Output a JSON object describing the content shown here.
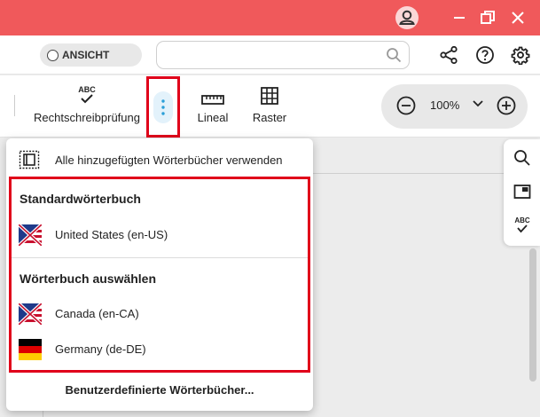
{
  "header": {
    "view_toggle_label": "ANSICHT",
    "search_placeholder": ""
  },
  "toolbar": {
    "spellcheck_label": "Rechtschreibprüfung",
    "spellcheck_icon_text": "ABC",
    "ruler_label": "Lineal",
    "grid_label": "Raster",
    "zoom_value": "100%"
  },
  "menu": {
    "use_all_label": "Alle hinzugefügten Wörterbücher verwenden",
    "default_section": "Standardwörterbuch",
    "default_dictionary": "United States (en-US)",
    "choose_section": "Wörterbuch auswählen",
    "dictionaries": [
      "Canada (en-CA)",
      "Germany (de-DE)"
    ],
    "custom_label": "Benutzerdefinierte Wörterbücher..."
  },
  "side_panel": {
    "spell_icon_text": "ABC"
  },
  "colors": {
    "titlebar": "#f0595b",
    "highlight": "#e0001a",
    "accent": "#2a9fd8"
  },
  "icons": [
    "user-icon",
    "minimize-icon",
    "restore-icon",
    "close-icon",
    "search-icon",
    "share-icon",
    "help-icon",
    "settings-icon",
    "spellcheck-icon",
    "more-vertical-icon",
    "ruler-icon",
    "grid-icon",
    "zoom-out-icon",
    "zoom-in-icon",
    "chevron-down-icon",
    "dictionaries-icon",
    "us-flag-icon",
    "de-flag-icon",
    "picture-in-picture-icon"
  ]
}
